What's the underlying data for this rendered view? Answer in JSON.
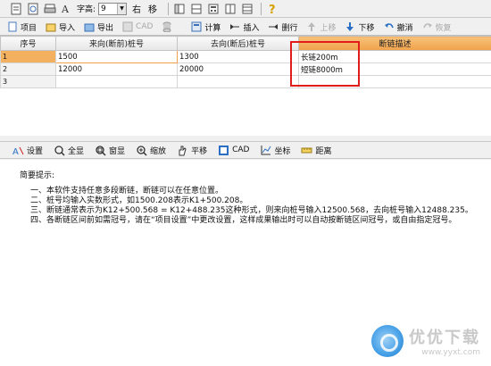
{
  "toolbar_top": {
    "font_height_label": "字高:",
    "font_height_value": "9",
    "align_right": "右",
    "move": "移",
    "icons": [
      "new-doc-icon",
      "preview-icon",
      "print-icon",
      "font-icon",
      "layout1-icon",
      "layout2-icon",
      "calculator-icon",
      "layout3-icon",
      "layout4-icon",
      "help-icon"
    ]
  },
  "toolbar_main": {
    "project": "项目",
    "import": "导入",
    "export": "导出",
    "cad": "CAD",
    "calculate": "计算",
    "insert": "插入",
    "delete_row": "删行",
    "move_up": "上移",
    "move_down": "下移",
    "undo": "撤消",
    "redo": "恢复"
  },
  "table": {
    "headers": [
      "序号",
      "来向(断前)桩号",
      "去向(断后)桩号",
      "断链描述"
    ],
    "rows": [
      [
        "1",
        "1500",
        "1300",
        "长链200m"
      ],
      [
        "2",
        "12000",
        "20000",
        "短链8000m"
      ],
      [
        "3",
        "",
        "",
        ""
      ]
    ]
  },
  "toolbar_bottom": {
    "settings": "设置",
    "full_view": "全显",
    "window": "窗显",
    "zoom": "缩放",
    "pan": "平移",
    "cad": "CAD",
    "coords": "坐标",
    "distance": "距离"
  },
  "tips": {
    "title": "简要提示:",
    "lines": [
      "一、本软件支持任意多段断链，断链可以在任意位置。",
      "二、桩号均输入实数形式，如1500.208表示K1+500.208。",
      "三、断链通常表示为K12+500.568 = K12+488.235这种形式，则来向桩号输入12500.568，去向桩号输入12488.235。",
      "四、各断链区间前如需冠号，请在“项目设置”中更改设置，这样成果输出时可以自动按断链区间冠号，或自由指定冠号。"
    ]
  },
  "watermark": {
    "text": "优优下载",
    "url": "www.yyxt.com"
  },
  "colors": {
    "header_highlight": "#f0a24a",
    "red_box": "#e21b1b",
    "selected_row": "#f3b05f"
  }
}
